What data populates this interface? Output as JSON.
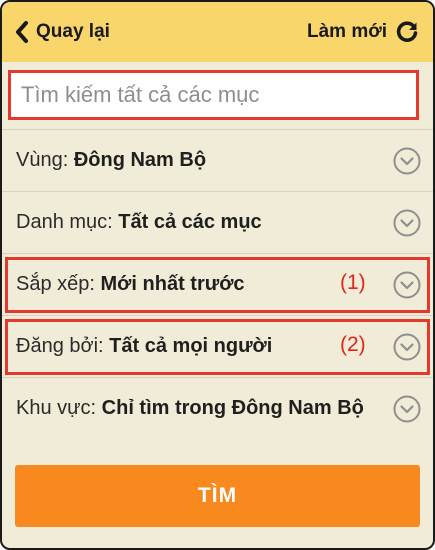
{
  "header": {
    "back_label": "Quay lại",
    "refresh_label": "Làm mới"
  },
  "search": {
    "placeholder": "Tìm kiếm tất cả các mục"
  },
  "filters": [
    {
      "key": "Vùng: ",
      "value": "Đông Nam Bộ",
      "marker": ""
    },
    {
      "key": "Danh mục: ",
      "value": "Tất cả các mục",
      "marker": ""
    },
    {
      "key": "Sắp xếp: ",
      "value": "Mới nhất trước",
      "marker": "(1)"
    },
    {
      "key": "Đăng bởi: ",
      "value": "Tất cả mọi người",
      "marker": "(2)"
    },
    {
      "key": "Khu vực: ",
      "value": "Chỉ tìm trong Đông Nam Bộ",
      "marker": ""
    }
  ],
  "submit_label": "TÌM",
  "icons": [
    "back-chevron-icon",
    "refresh-icon",
    "chevron-down-circle-icon"
  ],
  "colors": {
    "header_bg": "#f8d66c",
    "body_bg": "#f1ecd7",
    "highlight": "#e23b2e",
    "button": "#f7891f"
  }
}
